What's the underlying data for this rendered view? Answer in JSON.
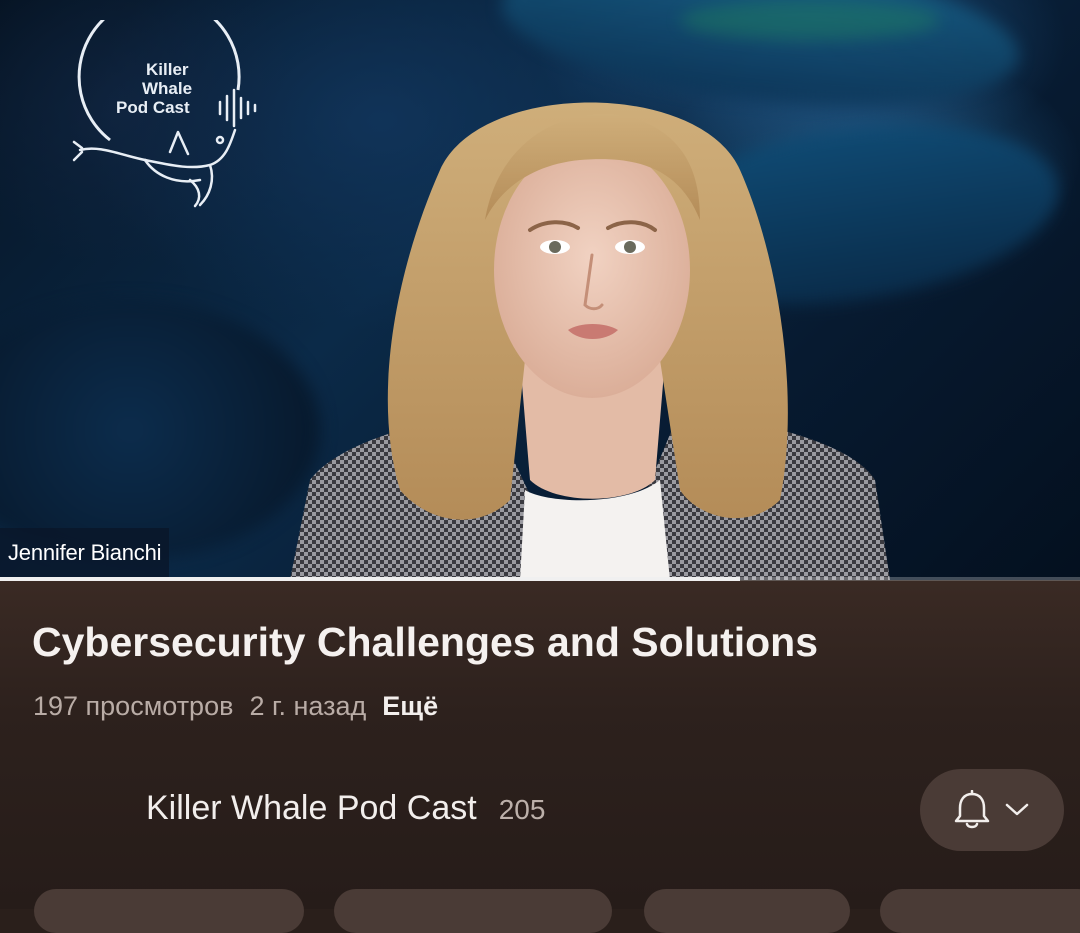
{
  "video": {
    "logo_text": [
      "Killer",
      "Whale",
      "Pod Cast"
    ],
    "speaker_name": "Jennifer Bianchi",
    "progress_fraction": 0.685
  },
  "info": {
    "title": "Cybersecurity Challenges and Solutions",
    "views": "197 просмотров",
    "age": "2 г. назад",
    "more_label": "Ещё"
  },
  "channel": {
    "name": "Killer Whale Pod Cast",
    "subscribers": "205",
    "bell_icon": "bell-icon",
    "chevron_icon": "chevron-down-icon"
  },
  "colors": {
    "panel_bg": "#2d211d",
    "button_bg": "#4a3b36",
    "meta_text": "#b9aca6"
  }
}
